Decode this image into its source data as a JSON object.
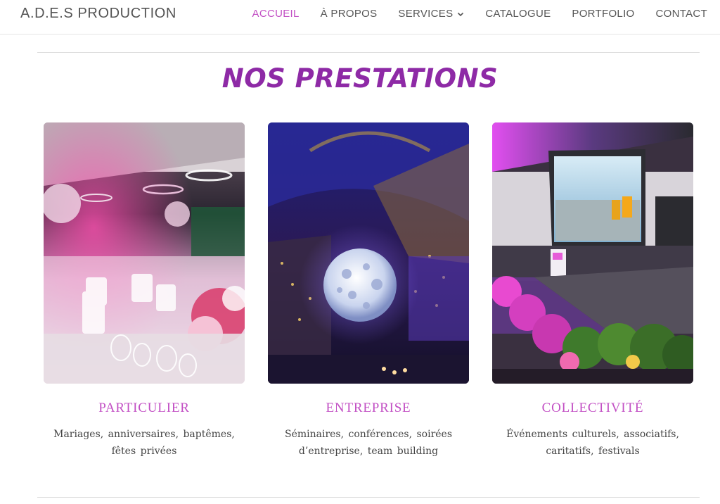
{
  "header": {
    "brand": "A.D.E.S PRODUCTION",
    "nav": [
      {
        "label": "ACCUEIL",
        "active": true
      },
      {
        "label": "À PROPOS"
      },
      {
        "label": "SERVICES",
        "has_dropdown": true
      },
      {
        "label": "CATALOGUE"
      },
      {
        "label": "PORTFOLIO"
      },
      {
        "label": "CONTACT"
      }
    ]
  },
  "main": {
    "title": "NOS PRESTATIONS",
    "cards": [
      {
        "title": "PARTICULIER",
        "line1": "Mariages, anniversaires, baptêmes,",
        "line2": "fêtes privées"
      },
      {
        "title": "ENTREPRISE",
        "line1": "Séminaires, conférences, soirées",
        "line2": "d’entreprise, team building"
      },
      {
        "title": "COLLECTIVITÉ",
        "line1": "Événements culturels, associatifs,",
        "line2": "caritatifs, festivals"
      }
    ]
  },
  "colors": {
    "accent": "#c24fc4",
    "title": "#8e2aa6",
    "text": "#444444",
    "nav": "#555555"
  }
}
